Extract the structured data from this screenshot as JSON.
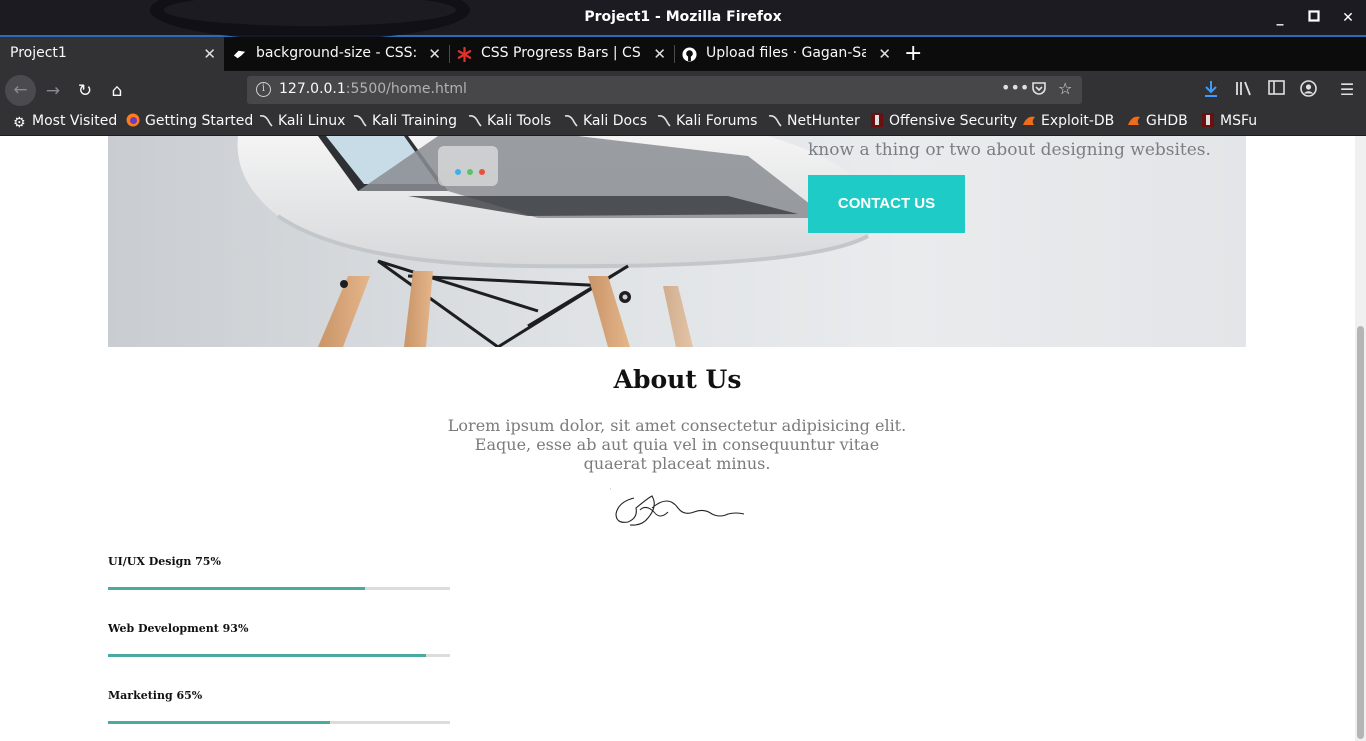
{
  "window": {
    "title": "Project1 - Mozilla Firefox"
  },
  "tabs": [
    {
      "label": "Project1",
      "active": true
    },
    {
      "label": "background-size - CSS: C",
      "active": false
    },
    {
      "label": "CSS Progress Bars | CSS",
      "active": false
    },
    {
      "label": "Upload files · Gagan-Saff",
      "active": false
    }
  ],
  "navbar": {
    "url_host": "127.0.0.1",
    "url_path": ":5500/home.html"
  },
  "bookmarks": [
    {
      "label": "Most Visited",
      "icon": "gear-icon"
    },
    {
      "label": "Getting Started",
      "icon": "firefox-icon"
    },
    {
      "label": "Kali Linux",
      "icon": "kali-dragon-icon"
    },
    {
      "label": "Kali Training",
      "icon": "kali-dragon-icon"
    },
    {
      "label": "Kali Tools",
      "icon": "kali-dragon-icon"
    },
    {
      "label": "Kali Docs",
      "icon": "kali-dragon-icon"
    },
    {
      "label": "Kali Forums",
      "icon": "kali-dragon-icon"
    },
    {
      "label": "NetHunter",
      "icon": "kali-dragon-icon"
    },
    {
      "label": "Offensive Security",
      "icon": "offsec-icon"
    },
    {
      "label": "Exploit-DB",
      "icon": "exploitdb-icon"
    },
    {
      "label": "GHDB",
      "icon": "exploitdb-icon"
    },
    {
      "label": "MSFu",
      "icon": "offsec-icon"
    }
  ],
  "hero": {
    "text": "know a thing or two about designing websites.",
    "cta_label": "CONTACT US",
    "accent": "#1ecbc6"
  },
  "about": {
    "title": "About Us",
    "text": "Lorem ipsum dolor, sit amet consectetur adipisicing elit. Eaque, esse ab aut quia vel in consequuntur vitae quaerat placeat minus."
  },
  "skills": [
    {
      "label": "UI/UX Design 75%",
      "percent": 75
    },
    {
      "label": "Web Development 93%",
      "percent": 93
    },
    {
      "label": "Marketing 65%",
      "percent": 65
    }
  ],
  "colors": {
    "progress": "#4aa9a0",
    "track": "#dcdcdc"
  }
}
